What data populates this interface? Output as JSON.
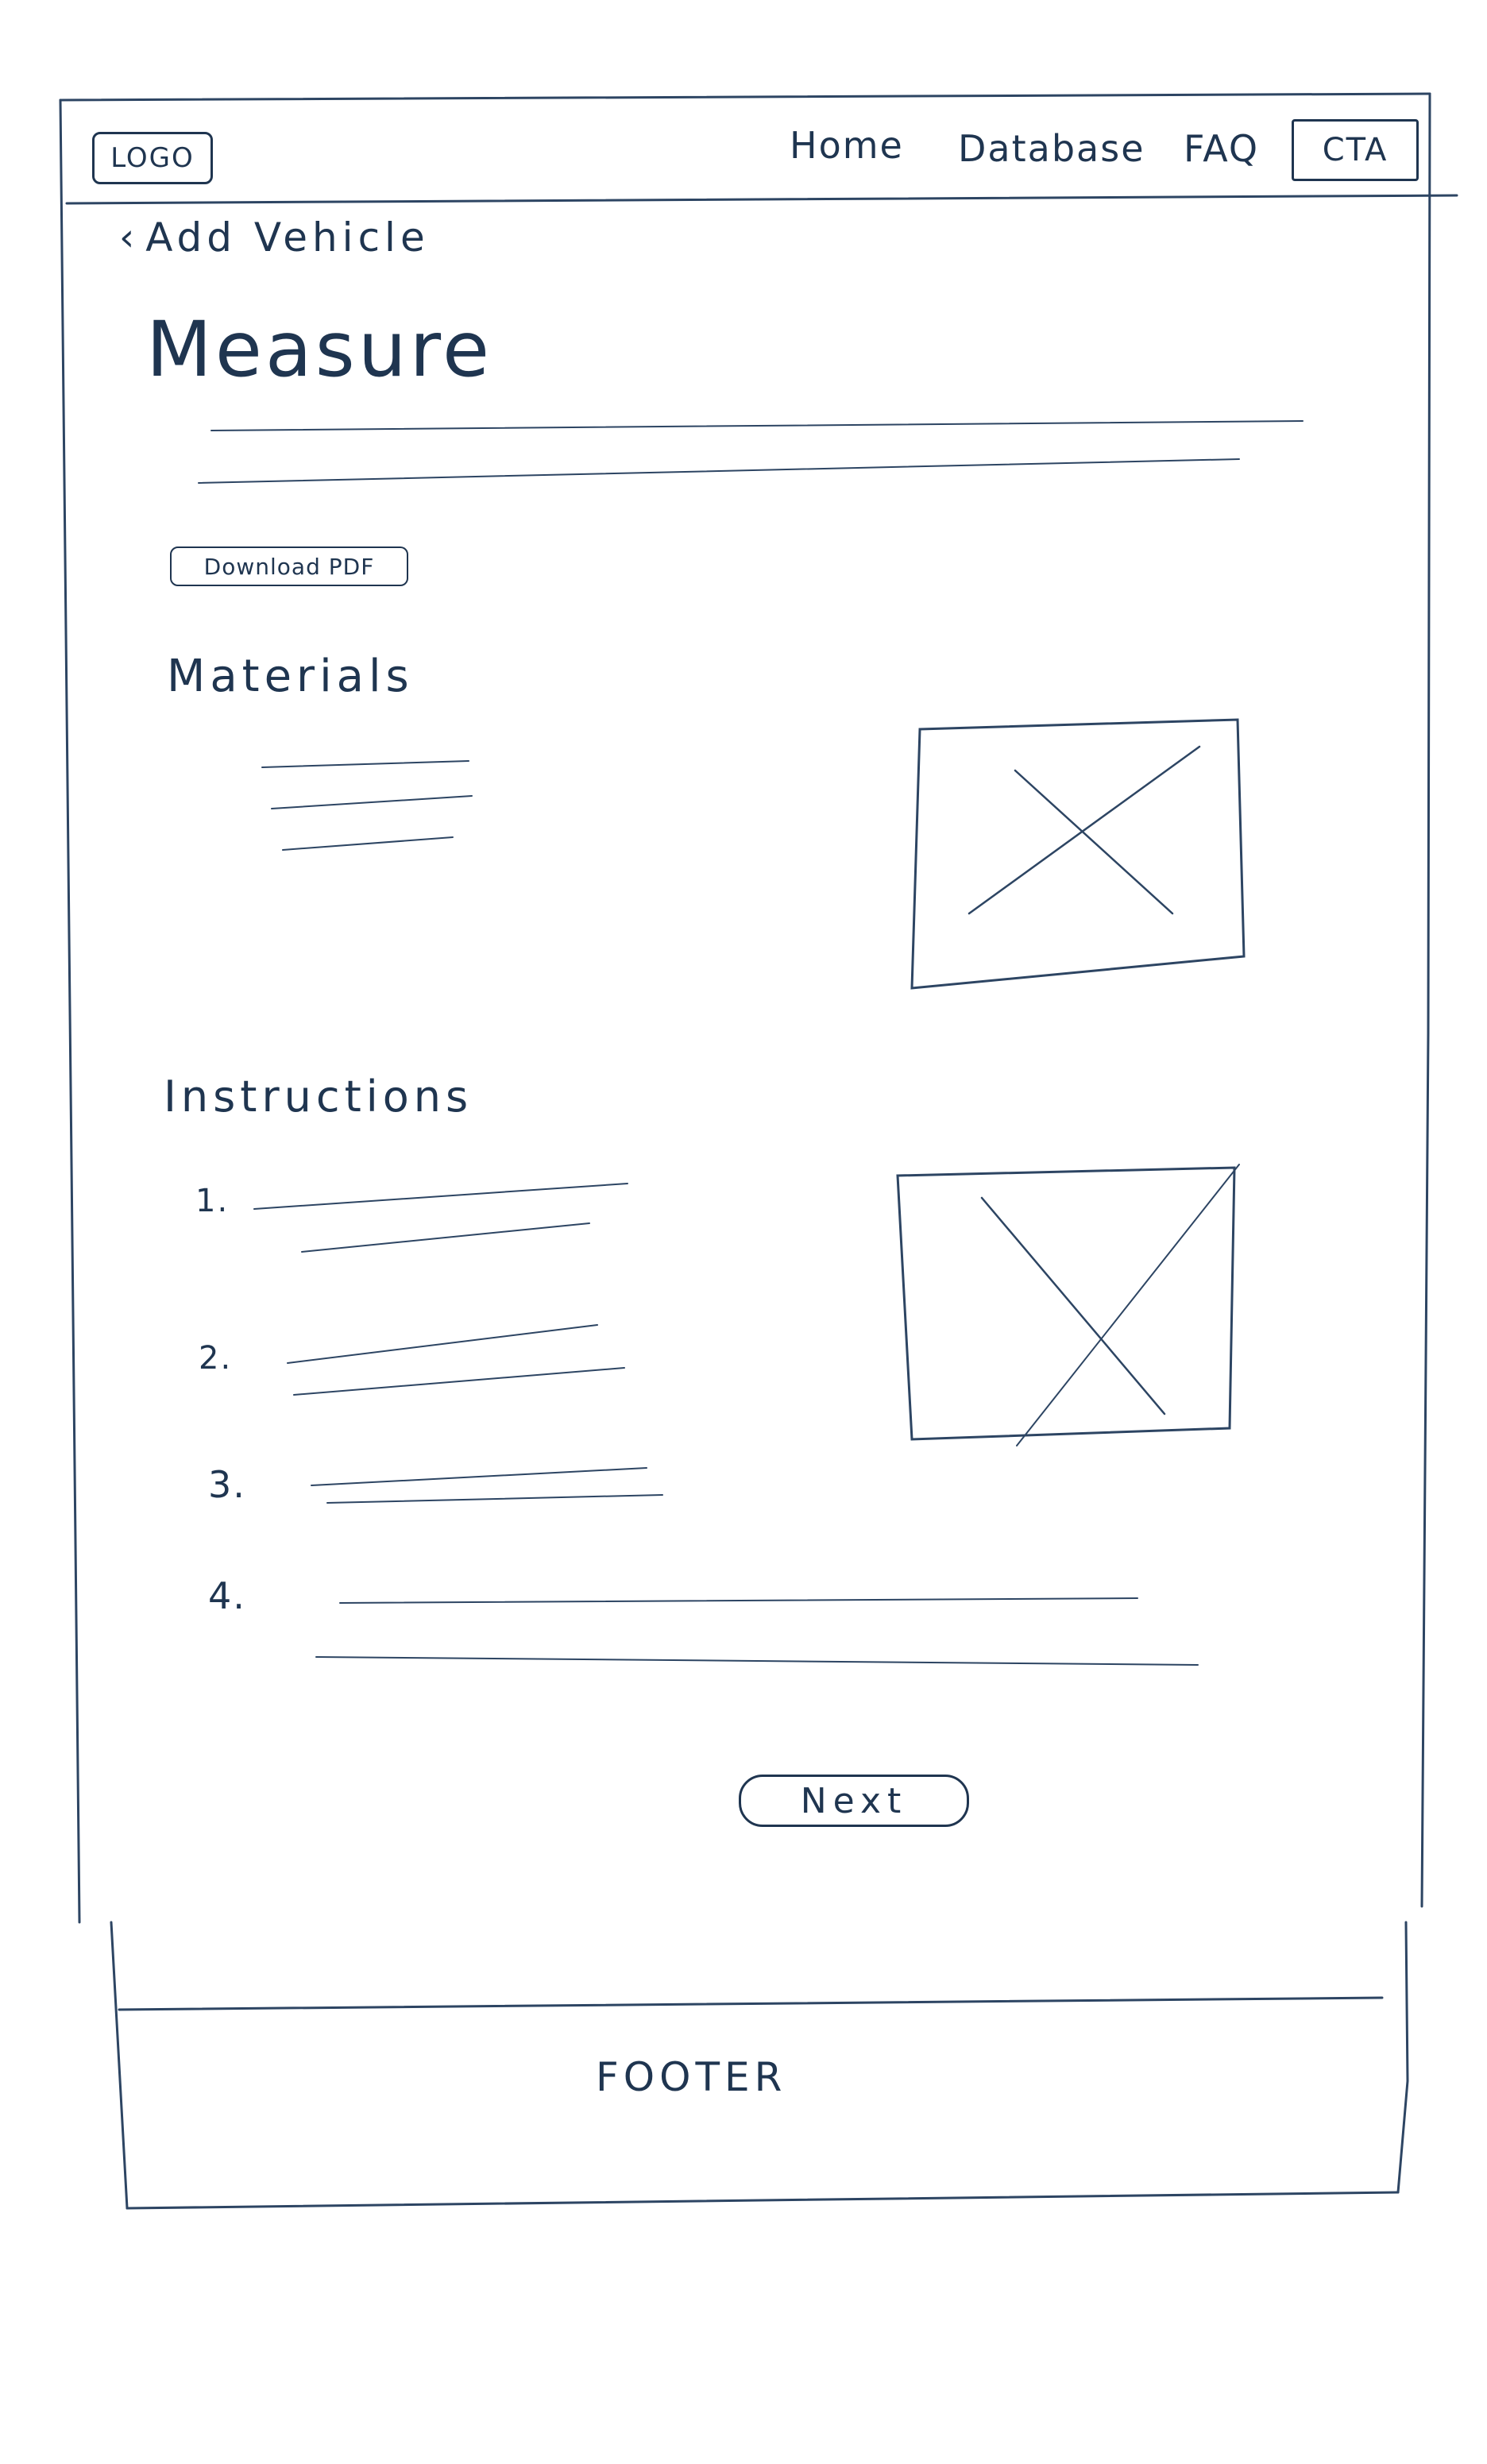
{
  "header": {
    "logo": "LOGO",
    "nav": [
      "Home",
      "Database",
      "FAQ"
    ],
    "cta": "CTA"
  },
  "breadcrumb": {
    "back_icon": "chevron-left-icon",
    "label": "Add Vehicle"
  },
  "page": {
    "title": "Measure",
    "download_pdf": "Download PDF"
  },
  "materials": {
    "heading": "Materials"
  },
  "instructions": {
    "heading": "Instructions",
    "steps": [
      "1.",
      "2.",
      "3.",
      "4."
    ]
  },
  "actions": {
    "next": "Next"
  },
  "footer": {
    "label": "FOOTER"
  }
}
